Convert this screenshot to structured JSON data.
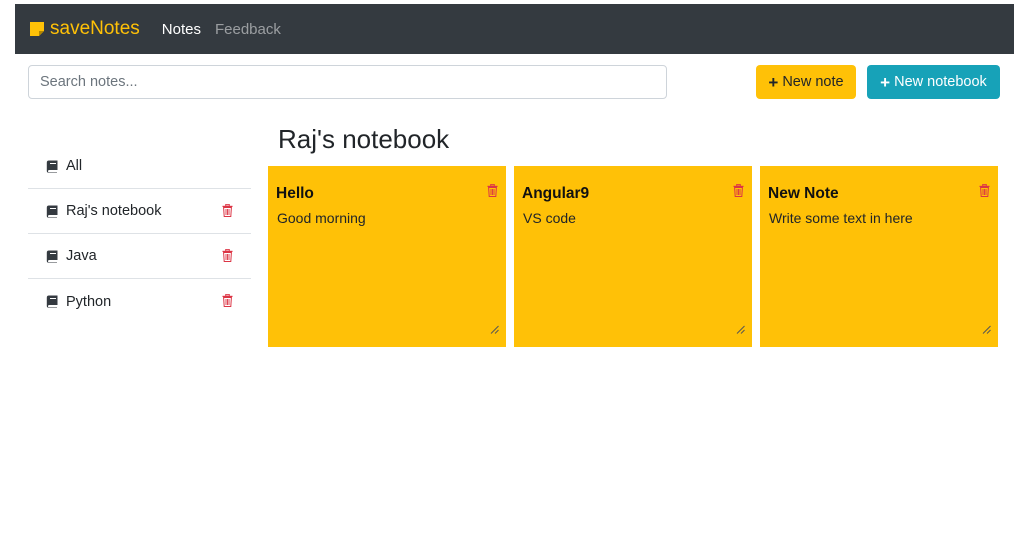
{
  "nav": {
    "brand": "saveNotes",
    "links": [
      "Notes",
      "Feedback"
    ]
  },
  "search": {
    "placeholder": "Search notes..."
  },
  "actions": {
    "new_note": "New note",
    "new_notebook": "New notebook"
  },
  "sidebar": {
    "items": [
      {
        "label": "All"
      },
      {
        "label": "Raj's notebook"
      },
      {
        "label": "Java"
      },
      {
        "label": "Python"
      }
    ]
  },
  "main": {
    "title": "Raj's notebook",
    "notes": [
      {
        "title": "Hello",
        "body": "Good morning"
      },
      {
        "title": "Angular9",
        "body": "VS code"
      },
      {
        "title": "New Note",
        "body": "Write some text in here"
      }
    ]
  },
  "colors": {
    "navbar": "#343a40",
    "accent": "#ffc107",
    "info": "#17a2b8",
    "danger": "#dc3545"
  },
  "icons": [
    "sticky-note-icon",
    "plus-icon",
    "book-icon",
    "trash-icon",
    "resize-handle-icon"
  ]
}
